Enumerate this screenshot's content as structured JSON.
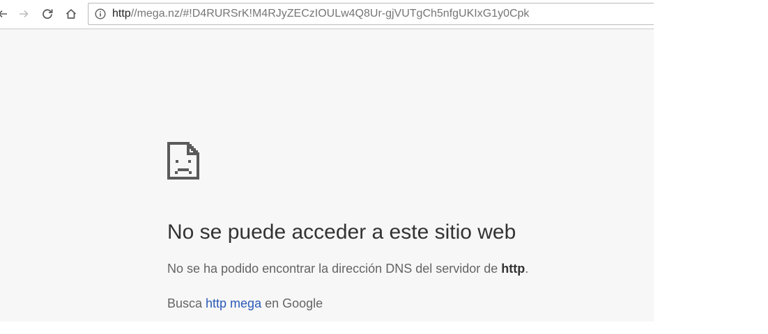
{
  "browser": {
    "address_bar": {
      "scheme": "http",
      "url_rest": "//mega.nz/#!D4RURSrK!M4RJyZECzIOULw4Q8Ur-gjVUTgCh5nfgUKIxG1y0Cpk"
    },
    "icons": {
      "back": "back-arrow-icon",
      "forward": "forward-arrow-icon",
      "reload": "reload-icon",
      "home": "home-icon",
      "info": "info-icon"
    }
  },
  "error": {
    "title": "No se puede acceder a este sitio web",
    "description_prefix": "No se ha podido encontrar la dirección DNS del servidor de ",
    "description_host": "http",
    "description_suffix": ".",
    "suggestion_prefix": "Busca ",
    "suggestion_link": "http mega",
    "suggestion_suffix": " en Google"
  },
  "colors": {
    "page_background": "#f7f7f7",
    "link": "#2a59b6",
    "icon": "#5a5a5a"
  }
}
